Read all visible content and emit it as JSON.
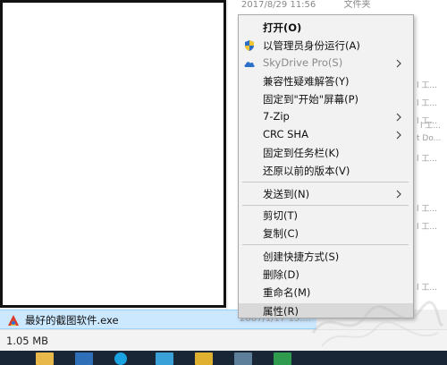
{
  "background": {
    "header": [
      "2017/8/29 11:56",
      "文件夹"
    ],
    "column_snippets": [
      "l 工...",
      "l 工...",
      "l 工...",
      "l 工...",
      "t Do...",
      "l 工...",
      "l 工...",
      "l 工...",
      "l 工..."
    ]
  },
  "context_menu": {
    "items": [
      {
        "label": "打开(O)"
      },
      {
        "label": "以管理员身份运行(A)"
      },
      {
        "label": "SkyDrive Pro(S)"
      },
      {
        "label": "兼容性疑难解答(Y)"
      },
      {
        "label": "固定到\"开始\"屏幕(P)"
      },
      {
        "label": "7-Zip"
      },
      {
        "label": "CRC SHA"
      },
      {
        "label": "固定到任务栏(K)"
      },
      {
        "label": "还原以前的版本(V)"
      },
      {
        "label": "发送到(N)"
      },
      {
        "label": "剪切(T)"
      },
      {
        "label": "复制(C)"
      },
      {
        "label": "创建快捷方式(S)"
      },
      {
        "label": "删除(D)"
      },
      {
        "label": "重命名(M)"
      },
      {
        "label": "属性(R)"
      }
    ]
  },
  "file_row": {
    "name": "最好的截图软件.exe",
    "date": "2007/1/17 13:..."
  },
  "status_bar": {
    "size": "1.05 MB"
  },
  "colors": {
    "selection": "#cce8ff",
    "menu_bg": "#f2f2f2",
    "menu_hover": "#d9d9d9",
    "taskbar": "#182635"
  }
}
